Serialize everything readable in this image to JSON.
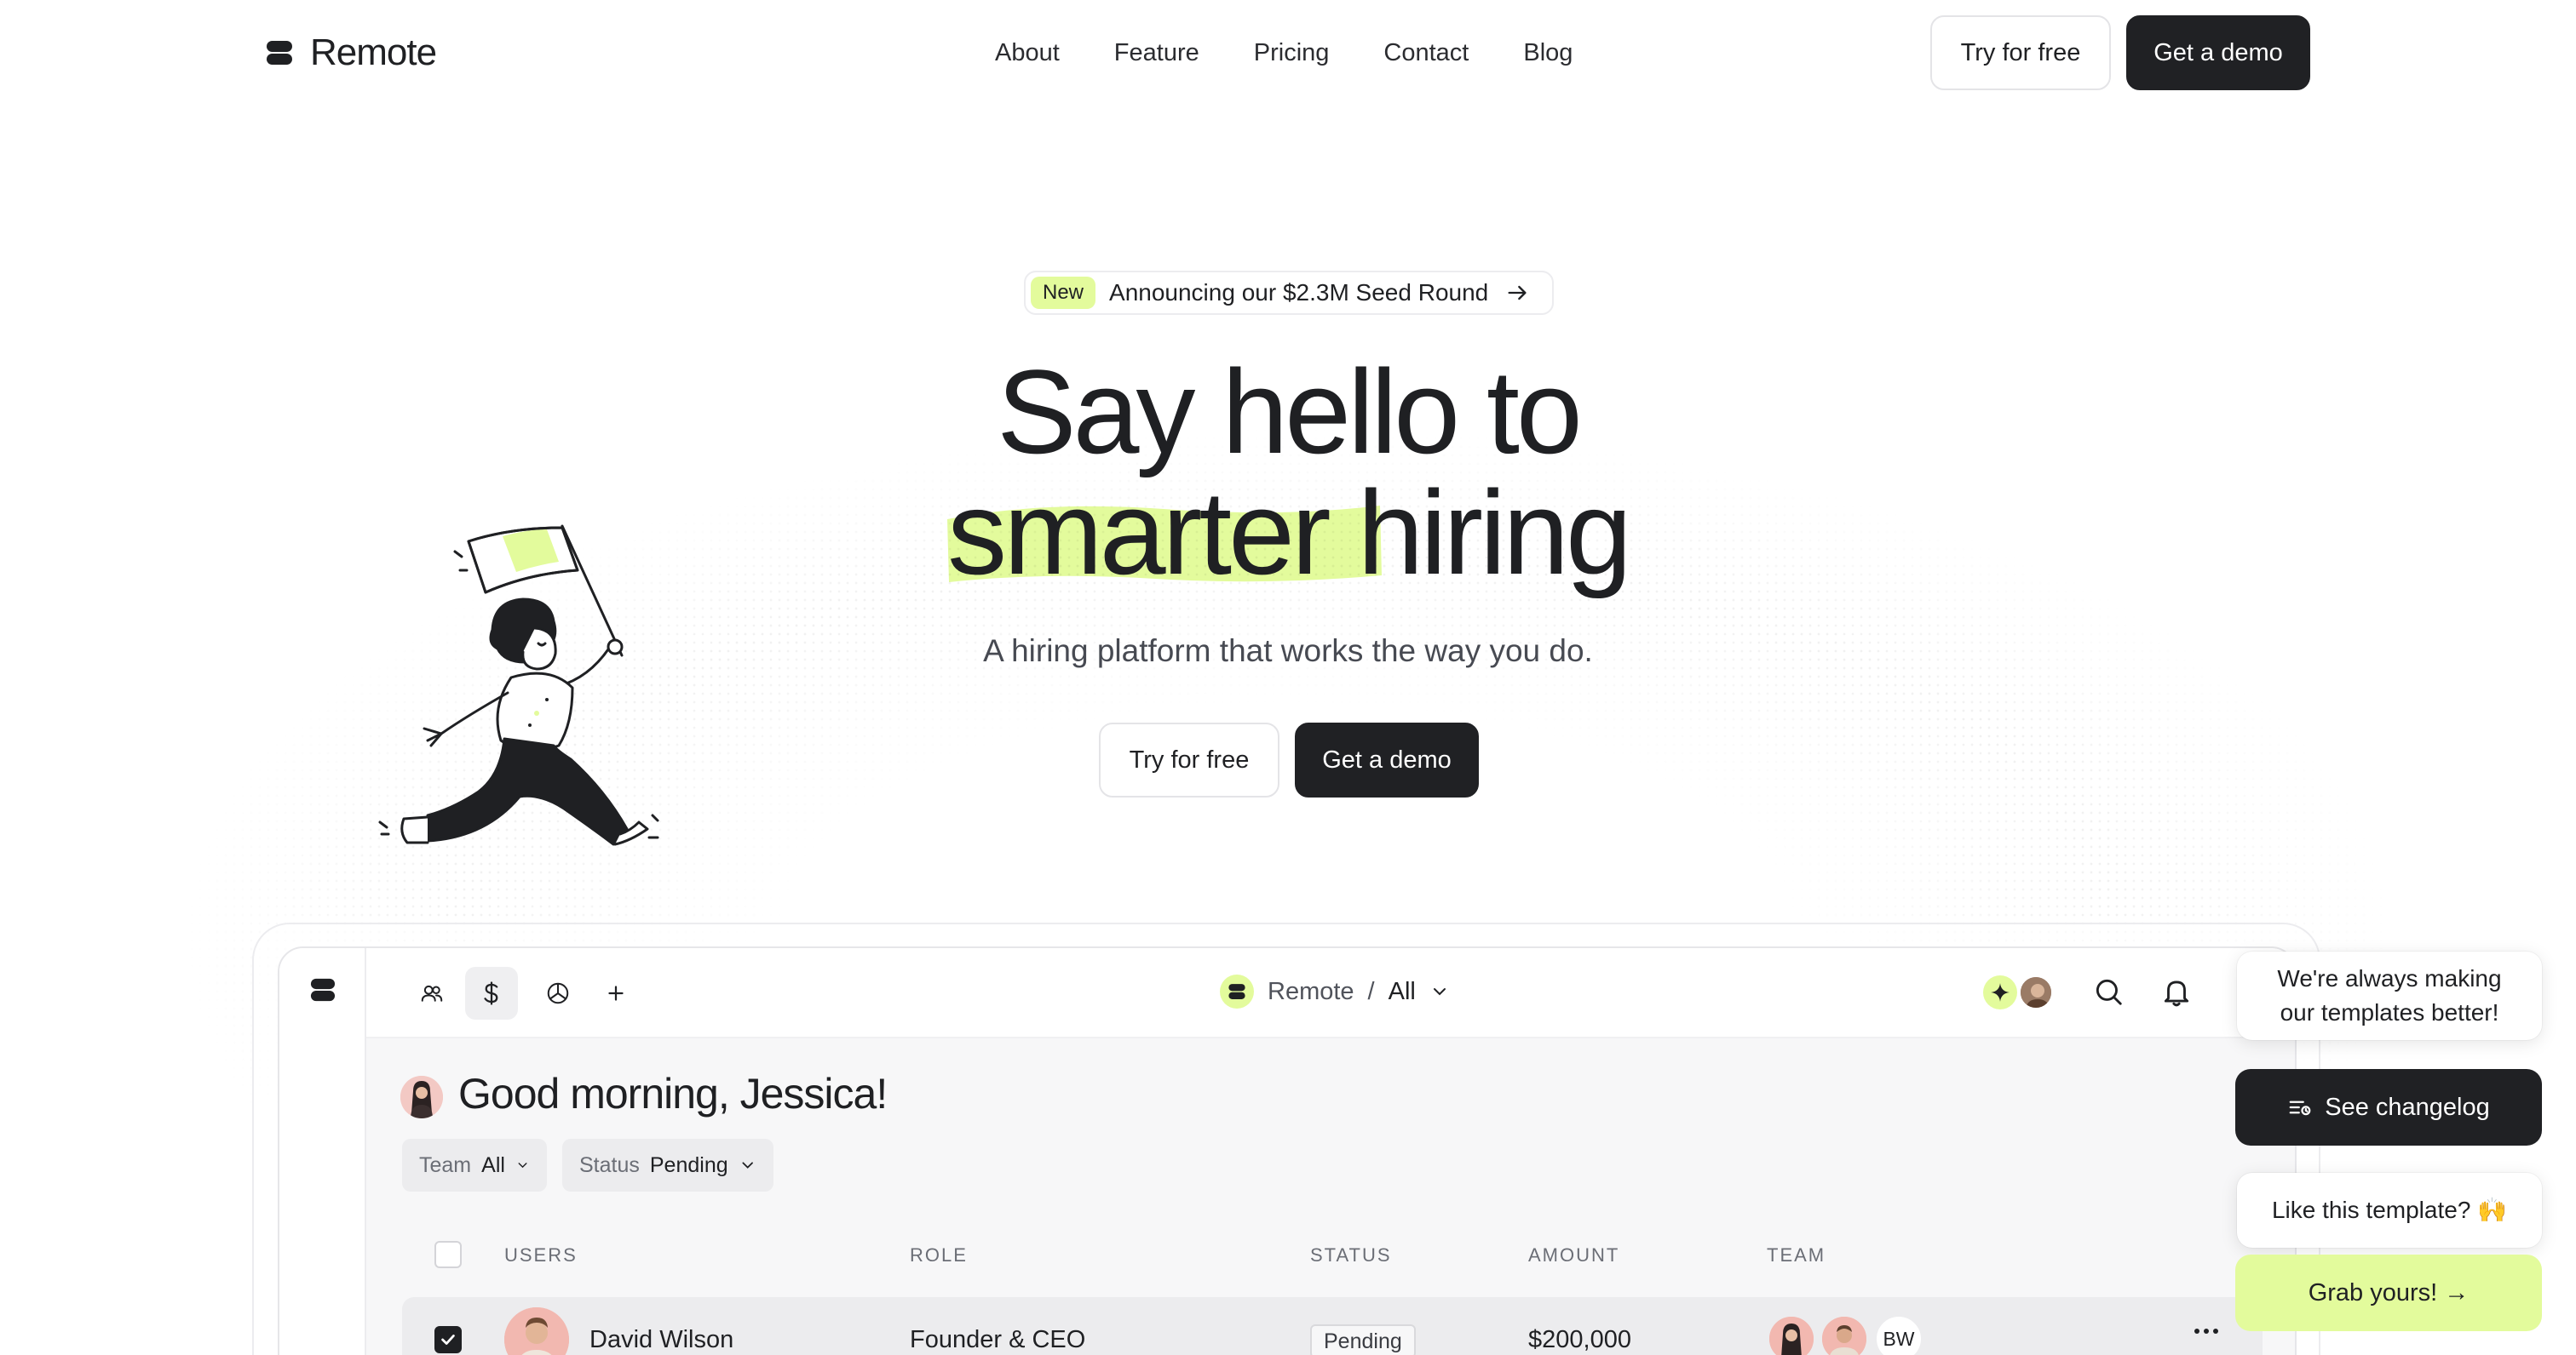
{
  "brand": {
    "name": "Remote"
  },
  "nav": {
    "links": [
      "About",
      "Feature",
      "Pricing",
      "Contact",
      "Blog"
    ],
    "try_label": "Try for free",
    "demo_label": "Get a demo"
  },
  "hero": {
    "badge_tag": "New",
    "badge_text": "Announcing our $2.3M Seed Round",
    "title_line1": "Say hello to",
    "title_highlight": "smarter",
    "title_rest": " hiring",
    "subtitle": "A hiring platform that works the way you do.",
    "try_label": "Try for free",
    "demo_label": "Get a demo"
  },
  "app": {
    "breadcrumb": {
      "org": "Remote",
      "separator": "/",
      "scope": "All"
    },
    "greeting": "Good morning, Jessica!",
    "filters": [
      {
        "label": "Team",
        "value": "All"
      },
      {
        "label": "Status",
        "value": "Pending"
      }
    ],
    "columns": [
      "USERS",
      "ROLE",
      "STATUS",
      "AMOUNT",
      "TEAM"
    ],
    "rows": [
      {
        "name": "David Wilson",
        "role": "Founder & CEO",
        "status": "Pending",
        "amount": "$200,000",
        "team_extra": "BW",
        "checked": true
      }
    ]
  },
  "float": {
    "message1": "We're always making our templates better!",
    "changelog_label": "See changelog",
    "message2": "Like this template? 🙌",
    "grab_label": "Grab yours! →"
  },
  "colors": {
    "accent": "#e3fb9c",
    "dark": "#202124",
    "text": "#1f2023",
    "muted": "#6b6e76"
  }
}
